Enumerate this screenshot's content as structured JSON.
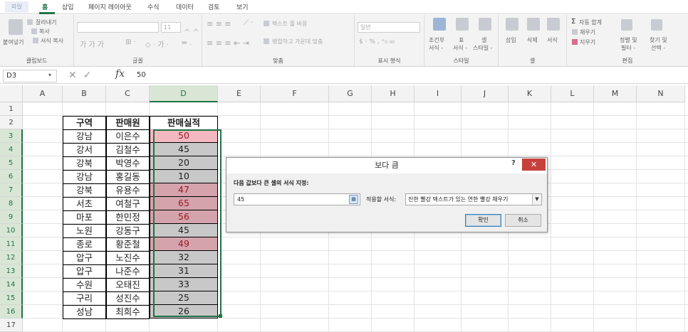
{
  "ribbon_tabs": {
    "file": "파일",
    "home": "홈",
    "insert": "삽입",
    "page_layout": "페이지 레이아웃",
    "formulas": "수식",
    "data": "데이터",
    "review": "검토",
    "view": "보기"
  },
  "clipboard": {
    "paste": "붙여넣기",
    "cut": "잘라내기",
    "copy": "복사",
    "format_painter": "서식 복사",
    "group": "클립보드"
  },
  "font": {
    "size": "11",
    "group": "글꼴"
  },
  "alignment": {
    "wrap_text": "텍스트 줄 바꿈",
    "merge_center": "병합하고 가운데 맞춤",
    "group": "맞춤"
  },
  "number": {
    "format": "일반",
    "group": "표시 형식"
  },
  "styles": {
    "conditional": "조건부",
    "conditional2": "서식 -",
    "table": "표",
    "table2": "서식 -",
    "cell": "셀",
    "cell2": "스타일 -",
    "group": "스타일"
  },
  "cells": {
    "insert": "삽입",
    "delete": "삭제",
    "format": "서식",
    "group": "셀"
  },
  "editing": {
    "autosum": "자동 합계",
    "fill": "채우기",
    "clear": "지우기",
    "sort_filter": "정렬 및",
    "sort_filter2": "필터 -",
    "find_select": "찾기 및",
    "find_select2": "선택 -",
    "group": "편집"
  },
  "formula_bar": {
    "name_box": "D3",
    "fx": "fx",
    "value": "50"
  },
  "columns": [
    "A",
    "B",
    "C",
    "D",
    "E",
    "F",
    "G",
    "H",
    "I",
    "J",
    "K",
    "L",
    "M",
    "N"
  ],
  "rows": [
    "1",
    "2",
    "3",
    "4",
    "5",
    "6",
    "7",
    "8",
    "9",
    "10",
    "11",
    "12",
    "13",
    "14",
    "15",
    "16",
    "17"
  ],
  "table": {
    "headers": [
      "구역",
      "판매원",
      "판매실적"
    ],
    "rows": [
      {
        "region": "강남",
        "seller": "이은수",
        "sales": "50",
        "highlight": true
      },
      {
        "region": "강서",
        "seller": "김철수",
        "sales": "45",
        "highlight": false
      },
      {
        "region": "강북",
        "seller": "박영수",
        "sales": "20",
        "highlight": false
      },
      {
        "region": "강남",
        "seller": "홍길동",
        "sales": "10",
        "highlight": false
      },
      {
        "region": "강북",
        "seller": "유용수",
        "sales": "47",
        "highlight": true
      },
      {
        "region": "서초",
        "seller": "여철구",
        "sales": "65",
        "highlight": true
      },
      {
        "region": "마포",
        "seller": "한민정",
        "sales": "56",
        "highlight": true
      },
      {
        "region": "노원",
        "seller": "강동구",
        "sales": "45",
        "highlight": false
      },
      {
        "region": "종로",
        "seller": "황준철",
        "sales": "49",
        "highlight": true
      },
      {
        "region": "압구",
        "seller": "노진수",
        "sales": "32",
        "highlight": false
      },
      {
        "region": "압구",
        "seller": "나준수",
        "sales": "31",
        "highlight": false
      },
      {
        "region": "수원",
        "seller": "오태진",
        "sales": "33",
        "highlight": false
      },
      {
        "region": "구리",
        "seller": "성진수",
        "sales": "25",
        "highlight": false
      },
      {
        "region": "성남",
        "seller": "최희수",
        "sales": "26",
        "highlight": false
      }
    ]
  },
  "colors": {
    "excel_green": "#217346",
    "highlight_fill": "#f4b8c0",
    "highlight_fill_selected": "#d4a3ab",
    "highlight_text": "#9c1b28",
    "normal_fill_selected": "#c8c8c8",
    "close_red": "#c8403b"
  },
  "dialog": {
    "title": "보다 큼",
    "help": "?",
    "close": "✕",
    "label": "다음 값보다 큰 셀의 서식 지정:",
    "input_value": "45",
    "format_label": "적용할 서식:",
    "format_value": "진한 빨강 텍스트가 있는 연한 빨강 채우기",
    "ok": "확인",
    "cancel": "취소"
  }
}
